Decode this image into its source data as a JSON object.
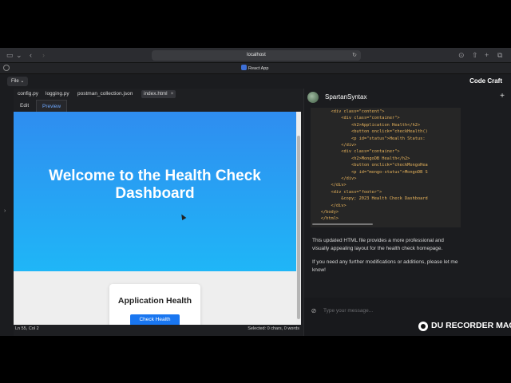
{
  "browser": {
    "url": "localhost",
    "tab_title": "React App",
    "icons": [
      "sidebar-icon",
      "back-icon",
      "forward-icon",
      "reload-icon",
      "download-icon",
      "share-icon",
      "new-tab-icon",
      "tabs-overview-icon"
    ]
  },
  "app": {
    "file_menu": "File",
    "app_name": "Code Craft"
  },
  "editor": {
    "file_tabs": [
      {
        "label": "config.py"
      },
      {
        "label": "logging.py"
      },
      {
        "label": "postman_collection.json"
      },
      {
        "label": "index.html",
        "active": true
      }
    ],
    "view_tabs": [
      {
        "label": "Edit"
      },
      {
        "label": "Preview",
        "active": true
      }
    ],
    "status": {
      "cursor_position": "Ln 55, Col 2",
      "selection": "Selected: 0 chars, 0 words"
    }
  },
  "preview": {
    "hero_title": "Welcome to the Health Check Dashboard",
    "card_title": "Application Health",
    "check_button": "Check Health",
    "hero_gradient": [
      "#2f8df0",
      "#1fb6f7"
    ],
    "button_color": "#1976f0"
  },
  "chat": {
    "user_name": "SpartanSyntax",
    "code_lines": [
      "        <div class=\"content\">",
      "            <div class=\"container\">",
      "                <h2>Application Health</h2>",
      "                <button onclick=\"checkHealth()",
      "                <p id=\"status\">Health Status:",
      "            </div>",
      "            <div class=\"container\">",
      "                <h2>MongoDB Health</h2>",
      "                <button onclick=\"checkMongoHea",
      "                <p id=\"mongo-status\">MongoDB S",
      "            </div>",
      "        </div>",
      "        <div class=\"footer\">",
      "            &copy; 2023 Health Check Dashboard",
      "        </div>",
      "    </body>",
      "    </html>"
    ],
    "paragraphs": [
      "This updated HTML file provides a more professional and visually appealing layout for the health check homepage.",
      "If you need any further modifications or additions, please let me know!"
    ],
    "input_placeholder": "Type your message..."
  },
  "watermark": {
    "text": "DU RECORDER MAC"
  }
}
